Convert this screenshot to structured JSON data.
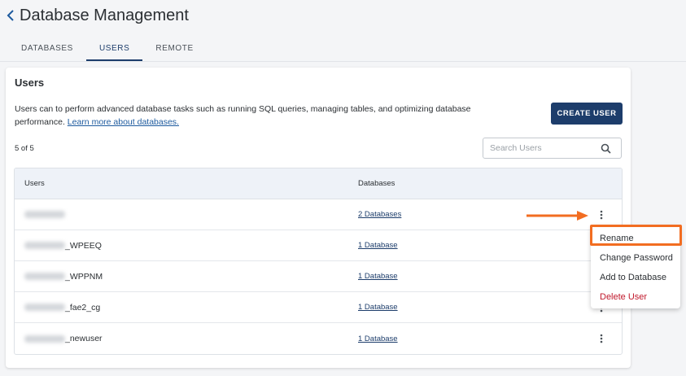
{
  "header": {
    "title": "Database Management"
  },
  "tabs": [
    {
      "label": "DATABASES",
      "active": false
    },
    {
      "label": "USERS",
      "active": true
    },
    {
      "label": "REMOTE",
      "active": false
    }
  ],
  "card": {
    "title": "Users",
    "description": "Users can to perform advanced database tasks such as running SQL queries, managing tables, and optimizing database performance.",
    "learn_more": "Learn more about databases.",
    "create_button": "CREATE USER",
    "count": "5 of 5",
    "search_placeholder": "Search Users"
  },
  "table": {
    "columns": [
      "Users",
      "Databases"
    ],
    "rows": [
      {
        "user_suffix": "",
        "databases": "2 Databases"
      },
      {
        "user_suffix": "_WPEEQ",
        "databases": "1 Database"
      },
      {
        "user_suffix": "_WPPNM",
        "databases": "1 Database"
      },
      {
        "user_suffix": "_fae2_cg",
        "databases": "1 Database"
      },
      {
        "user_suffix": "_newuser",
        "databases": "1 Database"
      }
    ]
  },
  "menu": {
    "items": [
      {
        "label": "Rename"
      },
      {
        "label": "Change Password"
      },
      {
        "label": "Add to Database"
      },
      {
        "label": "Delete User"
      }
    ]
  },
  "colors": {
    "accent": "#1d3d6b",
    "highlight": "#f26d21",
    "danger": "#c0182b"
  }
}
